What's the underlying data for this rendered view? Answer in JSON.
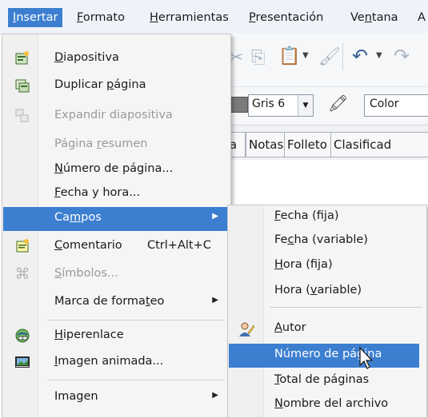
{
  "menubar": {
    "items": [
      {
        "pre": "",
        "ul": "I",
        "post": "nsertar"
      },
      {
        "pre": "",
        "ul": "F",
        "post": "ormato"
      },
      {
        "pre": "",
        "ul": "H",
        "post": "erramientas"
      },
      {
        "pre": "",
        "ul": "P",
        "post": "resentación"
      },
      {
        "pre": "Ve",
        "ul": "n",
        "post": "tana"
      },
      {
        "pre": "A",
        "ul": "",
        "post": ""
      }
    ]
  },
  "toolbar": {
    "color_value": "Gris 6",
    "color_mode": "Color"
  },
  "view_tabs": [
    {
      "label": "ema"
    },
    {
      "label": "Notas"
    },
    {
      "label": "Folleto"
    },
    {
      "label": "Clasificad"
    }
  ],
  "menu": {
    "items": [
      {
        "pre": "",
        "ul": "D",
        "post": "iapositiva",
        "icon": "new-slide-icon"
      },
      {
        "pre": "Duplicar ",
        "ul": "p",
        "post": "ágina",
        "icon": "duplicate-slide-icon"
      },
      {
        "pre": "Expandir diapositiva",
        "ul": "",
        "post": "",
        "icon": "expand-slide-icon"
      },
      {
        "pre": "Página ",
        "ul": "r",
        "post": "esumen"
      },
      {
        "pre": "",
        "ul": "N",
        "post": "úmero de página..."
      },
      {
        "pre": "",
        "ul": "F",
        "post": "echa y hora..."
      },
      {
        "pre": "Ca",
        "ul": "m",
        "post": "pos"
      },
      {
        "pre": "",
        "ul": "C",
        "post": "omentario",
        "accel": "Ctrl+Alt+C",
        "icon": "comment-icon"
      },
      {
        "pre": "",
        "ul": "S",
        "post": "ímbolos...",
        "icon": "symbols-icon"
      },
      {
        "pre": "Marca de forma",
        "ul": "t",
        "post": "eo"
      },
      {
        "pre": "",
        "ul": "H",
        "post": "iperenlace",
        "icon": "hyperlink-icon"
      },
      {
        "pre": "",
        "ul": "I",
        "post": "magen animada...",
        "icon": "animated-image-icon"
      },
      {
        "pre": "Imagen",
        "ul": "",
        "post": ""
      }
    ]
  },
  "submenu": {
    "items": [
      {
        "pre": "",
        "ul": "F",
        "post": "echa (fija)"
      },
      {
        "pre": "Fe",
        "ul": "c",
        "post": "ha (variable)"
      },
      {
        "pre": "",
        "ul": "H",
        "post": "ora (fija)"
      },
      {
        "pre": "Hora (",
        "ul": "v",
        "post": "ariable)"
      },
      {
        "pre": "",
        "ul": "A",
        "post": "utor",
        "icon": "author-icon"
      },
      {
        "pre": "Número de página",
        "ul": "",
        "post": ""
      },
      {
        "pre": "",
        "ul": "T",
        "post": "otal de páginas"
      },
      {
        "pre": "",
        "ul": "N",
        "post": "ombre del archivo"
      }
    ]
  }
}
